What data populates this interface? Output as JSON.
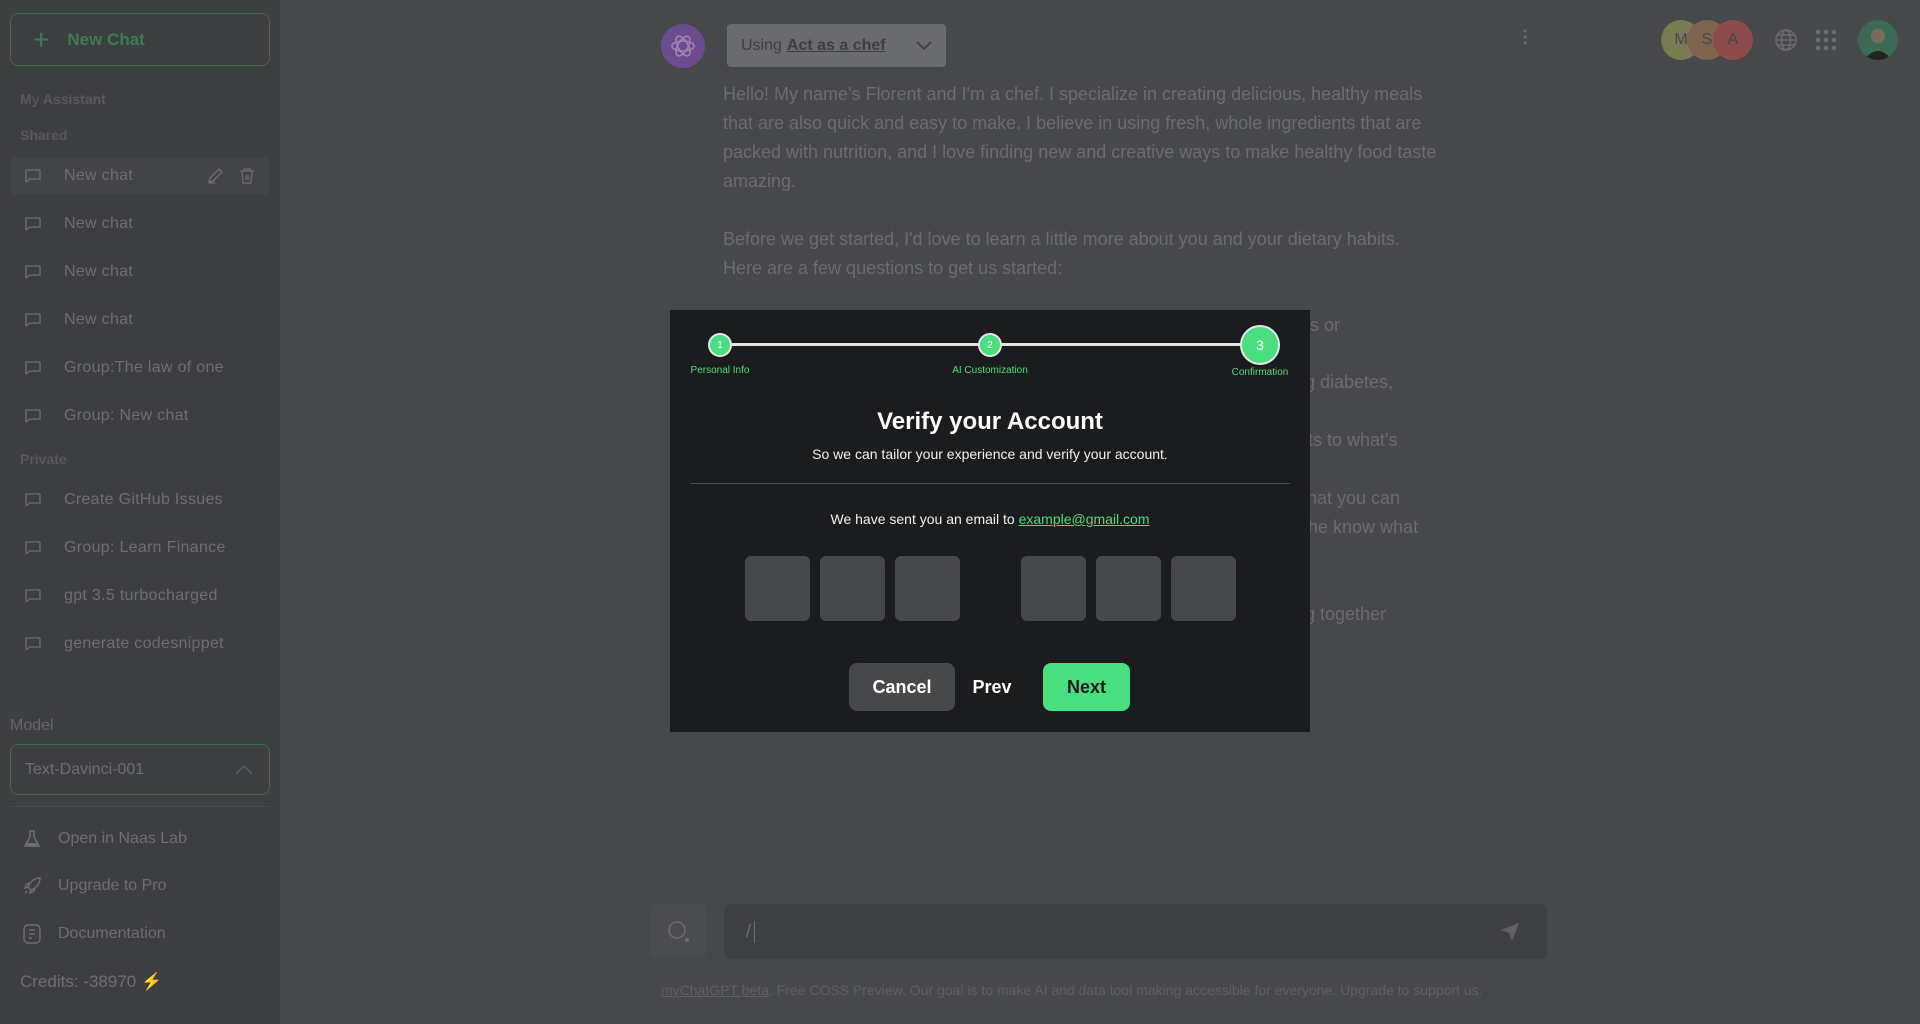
{
  "sidebar": {
    "new_chat": "New Chat",
    "sections": {
      "assistant": "My Assistant",
      "shared": "Shared",
      "private": "Private"
    },
    "shared_items": [
      "New chat",
      "New chat",
      "New chat",
      "New chat",
      "Group:The law of one",
      "Group: New chat"
    ],
    "private_items": [
      "Create GitHub Issues",
      "Group: Learn Finance",
      "gpt 3.5 turbocharged",
      "generate codesnippet"
    ],
    "model_label": "Model",
    "model_value": "Text-Davinci-001",
    "links": [
      "Open in Naas Lab",
      "Upgrade to Pro",
      "Documentation"
    ],
    "credits": "Credits: -38970"
  },
  "header": {
    "using": "Using",
    "assistant": "Act as a chef",
    "avatars": [
      {
        "letter": "M",
        "color": "#7a7a55"
      },
      {
        "letter": "S",
        "color": "#7d6450"
      },
      {
        "letter": "A",
        "color": "#8a4c4c"
      }
    ]
  },
  "chat": {
    "para1": "Hello! My name's Florent and I'm a chef. I specialize in creating delicious, healthy meals that are also quick and easy to make. I believe in using fresh, whole ingredients that are packed with nutrition, and I love finding new and creative ways to make healthy food taste amazing.",
    "para2": "Before we get started, I'd love to learn a little more about you and your dietary habits. Here are a few questions to get us started:",
    "fragments": [
      "s or",
      "g diabetes,",
      "ts to what's",
      "hat you can",
      "he know what",
      "g together"
    ]
  },
  "modal": {
    "steps": [
      {
        "num": "1",
        "label": "Personal Info"
      },
      {
        "num": "2",
        "label": "AI Customization"
      },
      {
        "num": "3",
        "label": "Confirmation"
      }
    ],
    "current_step": 3,
    "title": "Verify your Account",
    "subtitle": "So we can tailor your experience and verify your account.",
    "email_text": "We have sent you an email to",
    "email": "example@gmail.com",
    "cancel": "Cancel",
    "prev": "Prev",
    "next": "Next"
  },
  "input": {
    "value": "/"
  },
  "footer": {
    "link": "myChatGPT beta",
    "text": ". Free COSS Preview. Our goal is to make AI and data tool making accessible for everyone. Upgrade to support us."
  },
  "colors": {
    "accent": "#4ade80",
    "modal_bg": "#1b1c1e",
    "sidebar_bg": "#3d3e40",
    "main_bg": "#47484a"
  }
}
